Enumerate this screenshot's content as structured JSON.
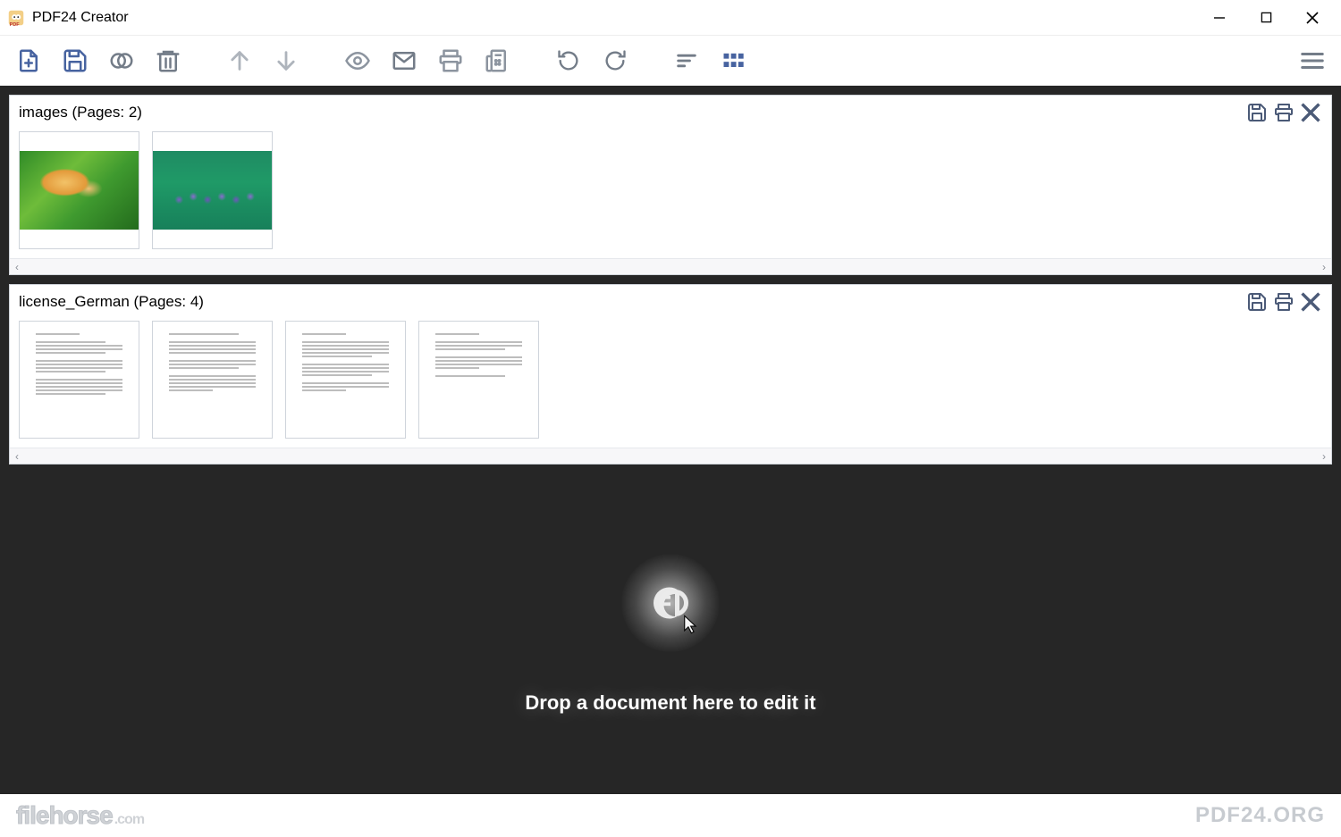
{
  "app": {
    "title": "PDF24 Creator"
  },
  "toolbar": {
    "new": "New",
    "save": "Save",
    "merge": "Merge",
    "delete": "Delete",
    "up": "Up",
    "down": "Down",
    "preview": "Preview",
    "email": "Email",
    "print": "Print",
    "fax": "Fax",
    "rotate_left": "Rotate Left",
    "rotate_right": "Rotate Right",
    "sort": "Sort",
    "grid": "Grid",
    "menu": "Menu"
  },
  "documents": [
    {
      "name": "images",
      "pages": 2,
      "label": "images (Pages: 2)",
      "type": "image"
    },
    {
      "name": "license_German",
      "pages": 4,
      "label": "license_German (Pages: 4)",
      "type": "text"
    }
  ],
  "dropzone": {
    "text": "Drop a document here to edit it"
  },
  "footer": {
    "left_main": "filehorse",
    "left_sub": ".com",
    "right": "PDF24.ORG"
  }
}
